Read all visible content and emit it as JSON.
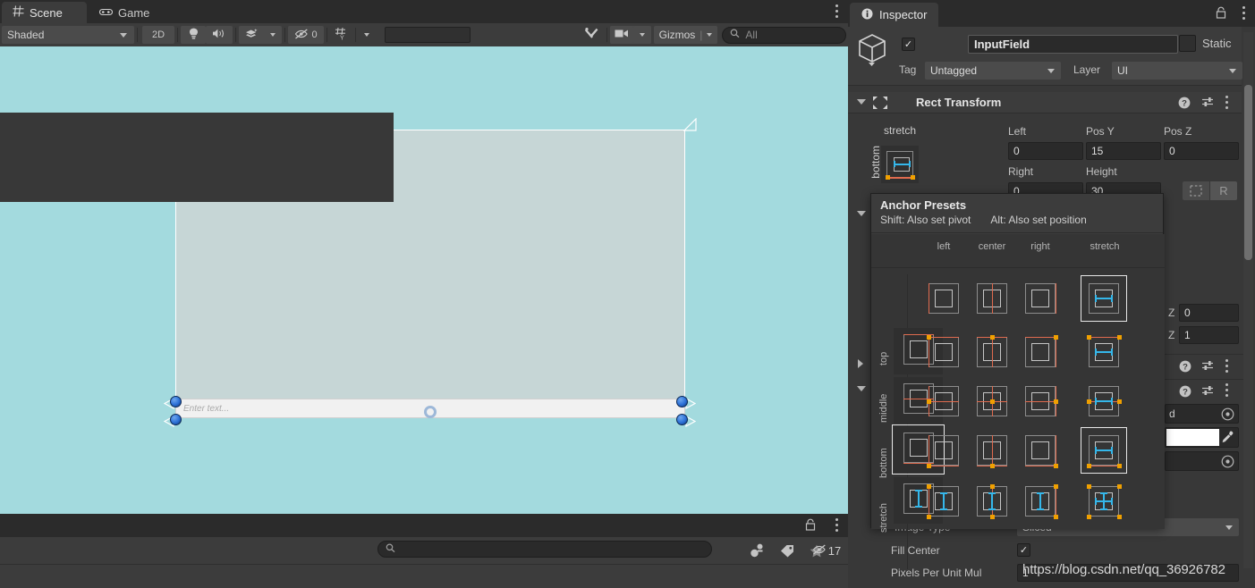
{
  "scene_panel": {
    "tabs": [
      {
        "label": "Scene",
        "icon": "grid-icon",
        "active": true
      },
      {
        "label": "Game",
        "icon": "gamepad-icon",
        "active": false
      }
    ],
    "toolbar": {
      "draw_mode": "Shaded",
      "two_d_label": "2D",
      "lighting_icon": "lightbulb-icon",
      "audio_icon": "speaker-icon",
      "fx_icon": "effects-icon",
      "hidden_objects_count": "0",
      "hidden_icon": "eye-slash-icon",
      "grid_icon": "grid-snap-icon",
      "tools_icon": "tools-icon",
      "camera_icon": "camera-icon",
      "gizmos_label": "Gizmos",
      "search_placeholder": "All",
      "search_icon": "search-icon",
      "menu_icon": "kebab-menu-icon"
    },
    "viewport": {
      "background_color": "#a3dade",
      "canvas_color": "#c6d6d6",
      "input_field_placeholder": "Enter text..."
    },
    "bottom_bar": {
      "lock_icon": "lock-icon",
      "menu_icon": "kebab-menu-icon",
      "search_placeholder": "",
      "search_icon": "search-icon",
      "buttons": [
        "gameobject-filter-icon",
        "tag-filter-icon",
        "favorite-icon"
      ],
      "visibility_icon": "eye-slash-icon",
      "visibility_count": "17"
    }
  },
  "inspector": {
    "tab_label": "Inspector",
    "tab_icon": "info-icon",
    "lock_icon": "lock-icon",
    "menu_icon": "kebab-menu-icon",
    "object": {
      "icon": "cube-icon",
      "enabled": true,
      "name": "InputField",
      "static_label": "Static",
      "static_checked": false,
      "tag_label": "Tag",
      "tag_value": "Untagged",
      "layer_label": "Layer",
      "layer_value": "UI"
    },
    "rect_transform": {
      "title": "Rect Transform",
      "help_icon": "help-icon",
      "preset_icon": "preset-icon",
      "menu_icon": "kebab-menu-icon",
      "anchor_preset_label": "stretch",
      "anchor_preset_row_label": "bottom",
      "fields": [
        {
          "label": "Left",
          "value": "0"
        },
        {
          "label": "Pos Y",
          "value": "15"
        },
        {
          "label": "Pos Z",
          "value": "0"
        },
        {
          "label": "Right",
          "value": "0"
        },
        {
          "label": "Height",
          "value": "30"
        }
      ],
      "blueprint_icon": "blueprint-icon",
      "raw_label": "R",
      "z_rows": [
        {
          "label": "Z",
          "value": "0"
        },
        {
          "label": "Z",
          "value": "1"
        }
      ]
    },
    "component_rows": [
      {
        "help_icon": "help-icon",
        "preset_icon": "preset-icon",
        "menu_icon": "kebab-menu-icon"
      },
      {
        "help_icon": "help-icon",
        "preset_icon": "preset-icon",
        "menu_icon": "kebab-menu-icon"
      }
    ],
    "hidden_fields": [
      {
        "suffix_text": "d",
        "picker_icon": "object-picker-icon"
      },
      {
        "swatch_color": "#ffffff",
        "picker_icon": "eyedropper-icon"
      },
      {
        "suffix_text": "",
        "picker_icon": "object-picker-icon"
      }
    ],
    "image_section": {
      "image_type_label": "Image Type",
      "image_type_value": "Sliced",
      "fill_center_label": "Fill Center",
      "fill_center_checked": true,
      "pixels_per_unit_label": "Pixels Per Unit Mul",
      "pixels_per_unit_value": "1"
    }
  },
  "anchor_presets_popup": {
    "title": "Anchor Presets",
    "hint_shift": "Shift: Also set pivot",
    "hint_alt": "Alt: Also set position",
    "column_headers": [
      "left",
      "center",
      "right",
      "stretch"
    ],
    "row_headers": [
      "top",
      "middle",
      "bottom",
      "stretch"
    ],
    "selected_column": "stretch",
    "selected_row": "bottom",
    "selected_header_column": "stretch",
    "selected_header_row": "bottom",
    "colors": {
      "anchor_line": "#e06b4f",
      "anchor_dot": "#f0a000",
      "stretch_arrow": "#35b7ea",
      "selection_outline": "#e8e8e8"
    }
  },
  "watermark": {
    "text": "https://blog.csdn.net/qq_36926782"
  }
}
